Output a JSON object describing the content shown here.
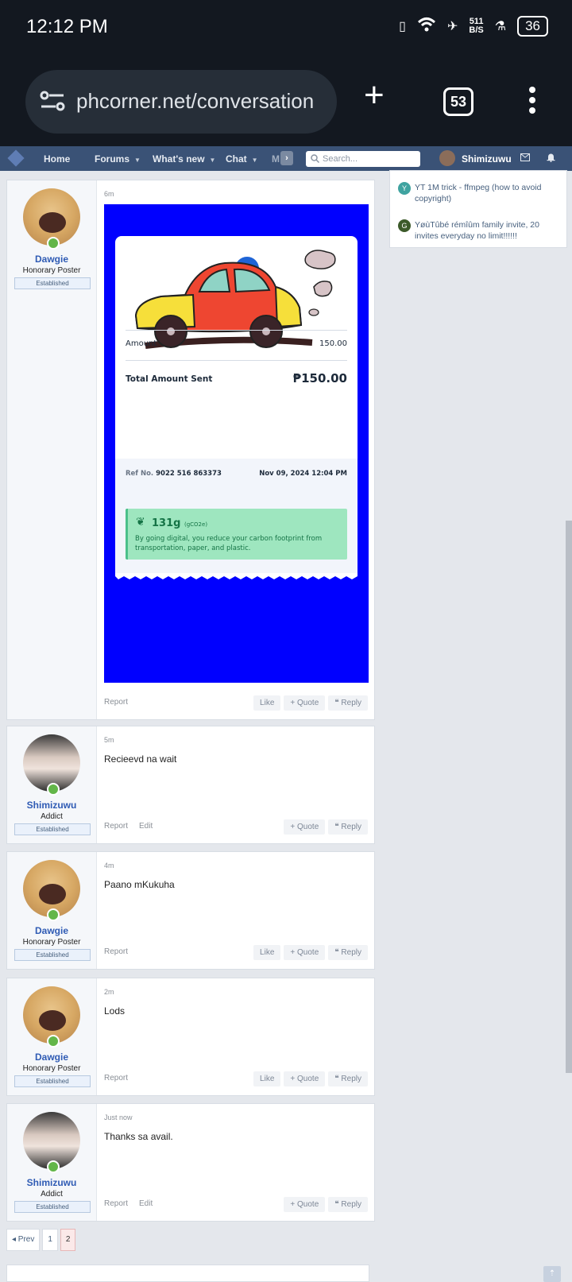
{
  "status_bar": {
    "time": "12:12 PM",
    "net_speed_top": "511",
    "net_speed_bottom": "B/S",
    "battery": "36"
  },
  "browser": {
    "url": "phcorner.net/conversation",
    "tab_count": "53"
  },
  "nav": {
    "items": [
      "Home",
      "Forums",
      "What's new",
      "Chat",
      "M"
    ],
    "search_placeholder": "Search...",
    "username": "Shimizuwu"
  },
  "sidebar": {
    "items": [
      {
        "initial": "Y",
        "text": "YT 1M trick - ffmpeg (how to avoid copyright)",
        "color": "#3fa3a0"
      },
      {
        "initial": "G",
        "text": "YøùTûbé rémîûm family invite, 20 invites everyday no limit!!!!!!",
        "color": "#3c5a2a"
      }
    ]
  },
  "receipt": {
    "amount_label": "Amount",
    "amount_value": "150.00",
    "total_label": "Total Amount Sent",
    "total_value": "₱150.00",
    "ref_label": "Ref No.",
    "ref_value": "9022 516 863373",
    "date": "Nov 09, 2024 12:04 PM",
    "eco_big": "131g",
    "eco_unit": "(gCO2e)",
    "eco_text": "By going digital, you reduce your carbon footprint from transportation, paper, and plastic."
  },
  "posts": [
    {
      "name": "Dawgie",
      "title": "Honorary Poster",
      "badge": "Established",
      "time": "6m",
      "message": "",
      "actions": [
        "Report"
      ],
      "buttons": [
        "Like",
        "+ Quote",
        "Reply"
      ]
    },
    {
      "name": "Shimizuwu",
      "title": "Addict",
      "badge": "Established",
      "time": "5m",
      "message": "Recieevd na wait",
      "actions": [
        "Report",
        "Edit"
      ],
      "buttons": [
        "+ Quote",
        "Reply"
      ]
    },
    {
      "name": "Dawgie",
      "title": "Honorary Poster",
      "badge": "Established",
      "time": "4m",
      "message": "Paano mKukuha",
      "actions": [
        "Report"
      ],
      "buttons": [
        "Like",
        "+ Quote",
        "Reply"
      ]
    },
    {
      "name": "Dawgie",
      "title": "Honorary Poster",
      "badge": "Established",
      "time": "2m",
      "message": "Lods",
      "actions": [
        "Report"
      ],
      "buttons": [
        "Like",
        "+ Quote",
        "Reply"
      ]
    },
    {
      "name": "Shimizuwu",
      "title": "Addict",
      "badge": "Established",
      "time": "Just now",
      "message": "Thanks sa avail.",
      "actions": [
        "Report",
        "Edit"
      ],
      "buttons": [
        "+ Quote",
        "Reply"
      ]
    }
  ],
  "pager": {
    "prev": "◂ Prev",
    "pages": [
      "1",
      "2"
    ],
    "current": "2"
  }
}
